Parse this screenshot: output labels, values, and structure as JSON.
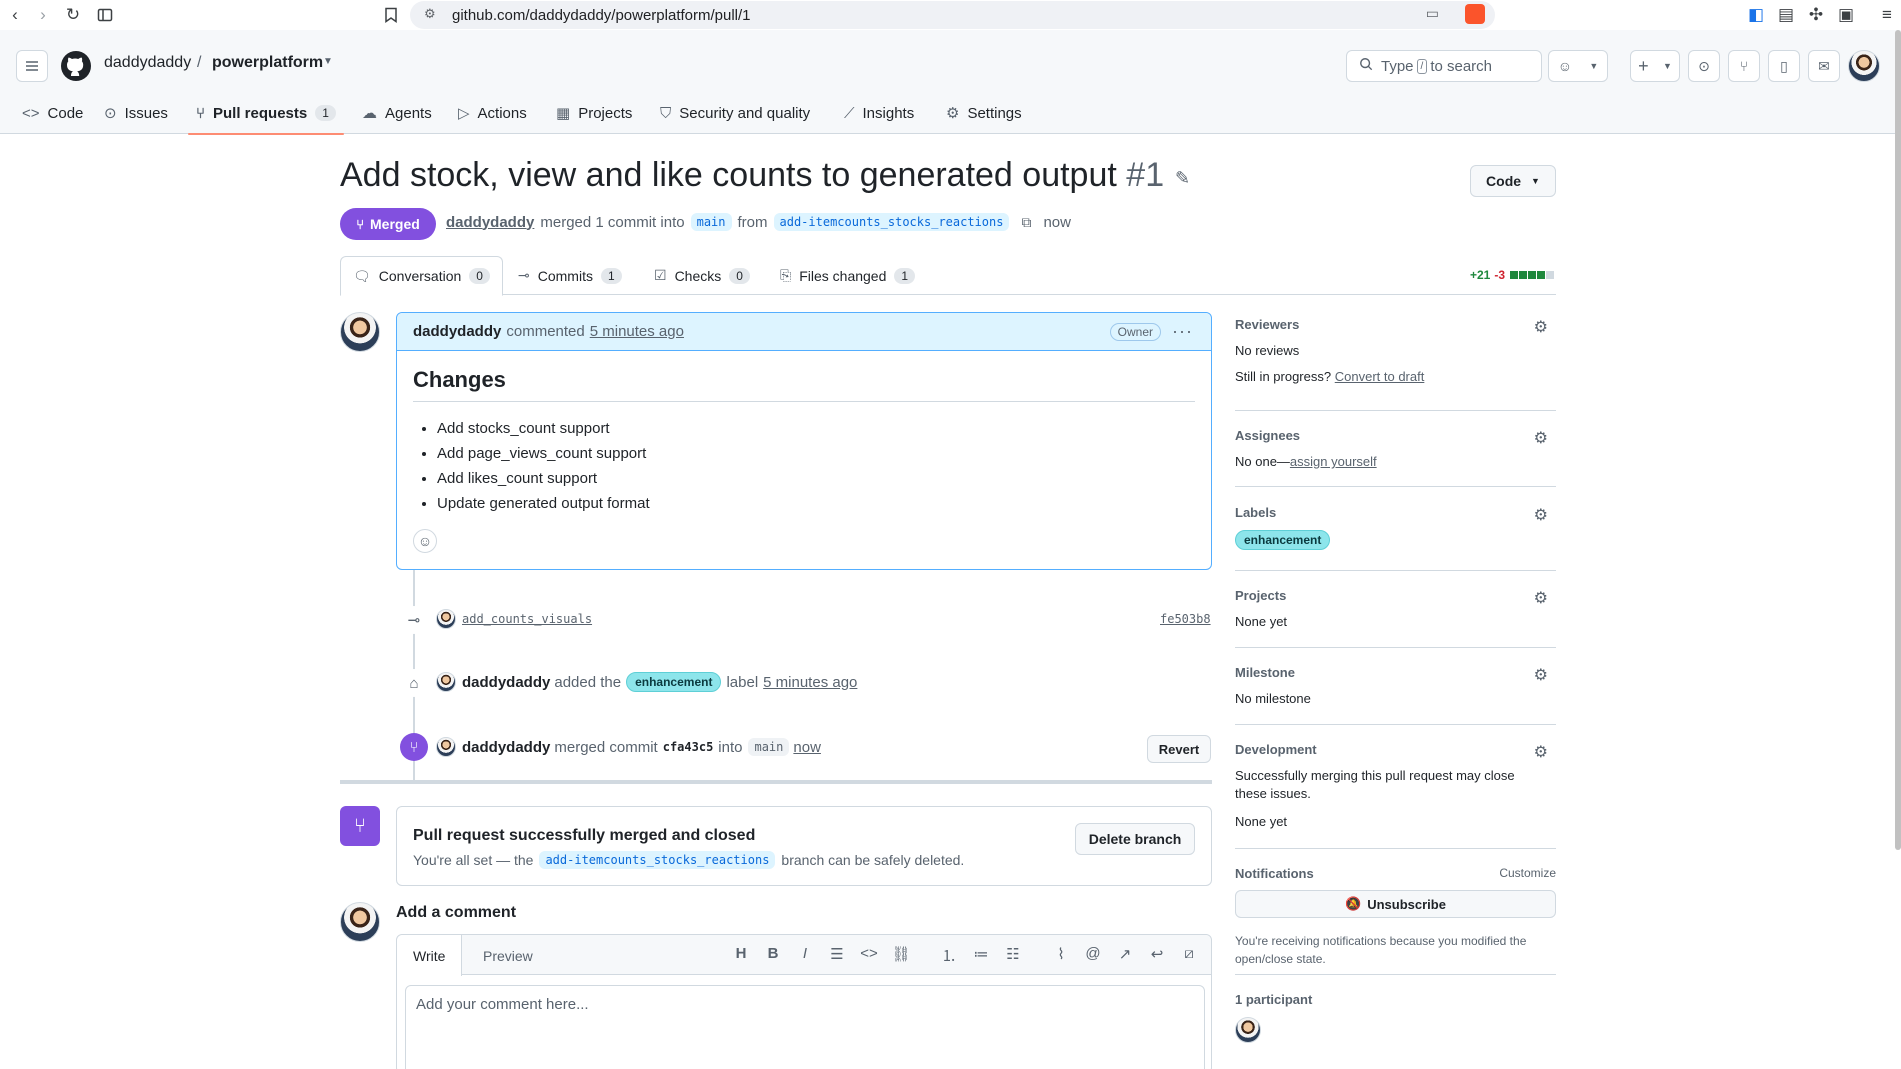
{
  "browser": {
    "url": "github.com/daddydaddy/powerplatform/pull/1"
  },
  "header": {
    "owner": "daddydaddy",
    "separator": "/",
    "repo": "powerplatform",
    "search_prefix": "Type",
    "search_key": "/",
    "search_suffix": "to search"
  },
  "repo_nav": [
    {
      "label": "Code",
      "icon": "code-icon"
    },
    {
      "label": "Issues",
      "icon": "issue-icon"
    },
    {
      "label": "Pull requests",
      "icon": "pull-request-icon",
      "count": "1"
    },
    {
      "label": "Agents",
      "icon": "agent-icon"
    },
    {
      "label": "Actions",
      "icon": "play-icon"
    },
    {
      "label": "Projects",
      "icon": "table-icon"
    },
    {
      "label": "Security and quality",
      "icon": "shield-icon"
    },
    {
      "label": "Insights",
      "icon": "graph-icon"
    },
    {
      "label": "Settings",
      "icon": "gear-icon"
    }
  ],
  "pr": {
    "title": "Add stock, view and like counts to generated output",
    "number": "#1",
    "code_button": "Code",
    "state": "Merged",
    "author": "daddydaddy",
    "merged_text": "merged 1 commit into",
    "base_branch": "main",
    "from_text": "from",
    "head_branch": "add-itemcounts_stocks_reactions",
    "time": "now"
  },
  "tabs": [
    {
      "label": "Conversation",
      "count": "0",
      "icon": "comment-icon"
    },
    {
      "label": "Commits",
      "count": "1",
      "icon": "commit-icon"
    },
    {
      "label": "Checks",
      "count": "0",
      "icon": "checklist-icon"
    },
    {
      "label": "Files changed",
      "count": "1",
      "icon": "file-diff-icon"
    }
  ],
  "diffstat": {
    "additions": "+21",
    "deletions": "-3",
    "colors": {
      "add": "#1f883d",
      "del": "#cf222e",
      "neutral": "#d1d9e0"
    }
  },
  "comment": {
    "author": "daddydaddy",
    "action": "commented",
    "time": "5 minutes ago",
    "badge": "Owner",
    "heading": "Changes",
    "items": [
      "Add stocks_count support",
      "Add page_views_count support",
      "Add likes_count support",
      "Update generated output format"
    ]
  },
  "timeline": {
    "commit_message": "add_counts_visuals",
    "commit_sha": "fe503b8",
    "label_actor": "daddydaddy",
    "label_action": "added the",
    "label_name": "enhancement",
    "label_suffix": "label",
    "label_time": "5 minutes ago",
    "merge_actor": "daddydaddy",
    "merge_action": "merged commit",
    "merge_sha": "cfa43c5",
    "merge_into": "into",
    "merge_branch": "main",
    "merge_time": "now",
    "revert_label": "Revert"
  },
  "merge_box": {
    "heading": "Pull request successfully merged and closed",
    "text_before": "You're all set — the",
    "branch": "add-itemcounts_stocks_reactions",
    "text_after": "branch can be safely deleted.",
    "delete_label": "Delete branch"
  },
  "comment_form": {
    "title": "Add a comment",
    "write_tab": "Write",
    "preview_tab": "Preview",
    "placeholder": "Add your comment here..."
  },
  "sidebar": {
    "reviewers": {
      "title": "Reviewers",
      "value": "No reviews",
      "draft_prefix": "Still in progress?",
      "draft_link": "Convert to draft"
    },
    "assignees": {
      "title": "Assignees",
      "value": "No one—",
      "link": "assign yourself"
    },
    "labels": {
      "title": "Labels",
      "label": "enhancement",
      "label_color": "#8de5eb"
    },
    "projects": {
      "title": "Projects",
      "value": "None yet"
    },
    "milestone": {
      "title": "Milestone",
      "value": "No milestone"
    },
    "development": {
      "title": "Development",
      "text": "Successfully merging this pull request may close these issues.",
      "value": "None yet"
    },
    "notifications": {
      "title": "Notifications",
      "customize": "Customize",
      "button": "Unsubscribe",
      "reason": "You're receiving notifications because you modified the open/close state."
    },
    "participants": {
      "title": "1 participant"
    }
  }
}
